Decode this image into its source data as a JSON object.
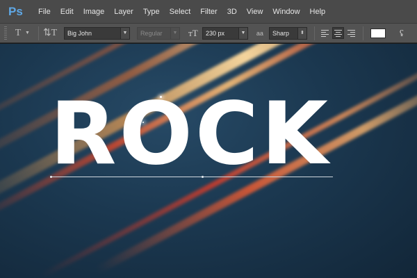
{
  "app": {
    "logo": "Ps",
    "menu": [
      "File",
      "Edit",
      "Image",
      "Layer",
      "Type",
      "Select",
      "Filter",
      "3D",
      "View",
      "Window",
      "Help"
    ]
  },
  "options_bar": {
    "tool_icon": "type-tool-icon",
    "orientation_icon": "text-orientation-icon",
    "font_family": "Big John",
    "font_style": "Regular",
    "font_size": "230 px",
    "antialias_label": "aa",
    "antialias": "Sharp",
    "text_color": "#ffffff"
  },
  "canvas": {
    "text": "ROCK"
  }
}
